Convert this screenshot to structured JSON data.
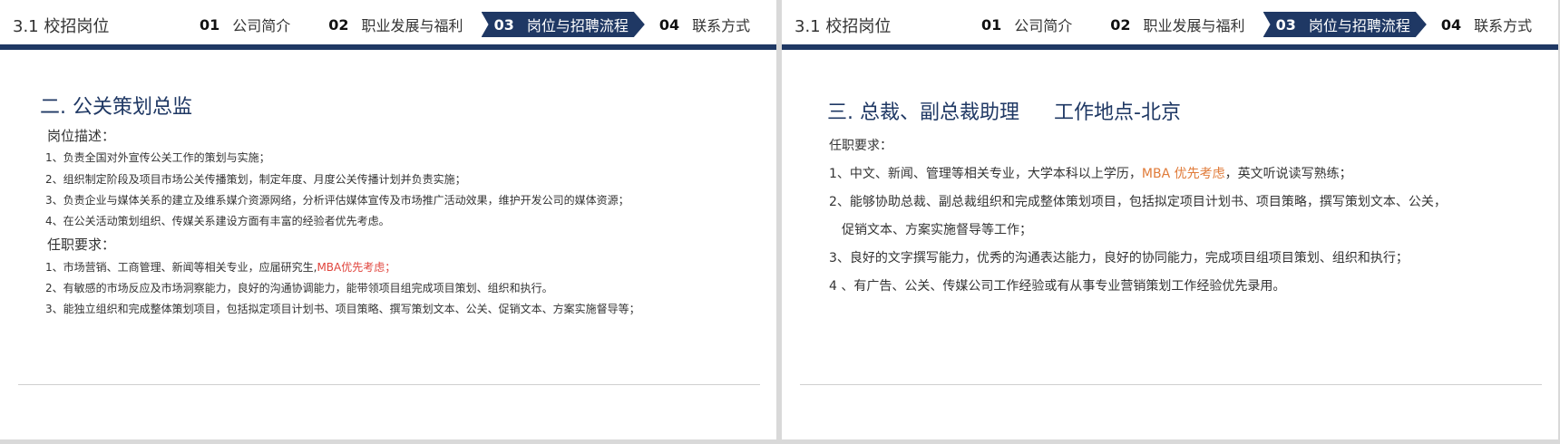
{
  "header": {
    "section_label": "3.1 校招岗位",
    "nav": [
      {
        "num": "01",
        "label": "公司简介",
        "active": false
      },
      {
        "num": "02",
        "label": "职业发展与福利",
        "active": false
      },
      {
        "num": "03",
        "label": "岗位与招聘流程",
        "active": true
      },
      {
        "num": "04",
        "label": "联系方式",
        "active": false
      }
    ]
  },
  "left": {
    "title": "二. 公关策划总监",
    "desc_heading": "岗位描述：",
    "desc_items": [
      "1、负责全国对外宣传公关工作的策划与实施；",
      "2、组织制定阶段及项目市场公关传播策划，制定年度、月度公关传播计划并负责实施；",
      "3、负责企业与媒体关系的建立及维系媒介资源网络，分析评估媒体宣传及市场推广活动效果，维护开发公司的媒体资源；",
      "4、在公关活动策划组织、传媒关系建设方面有丰富的经验者优先考虑。"
    ],
    "req_heading": "任职要求：",
    "req_1_main": "1、市场营销、工商管理、新闻等相关专业，应届研究生,",
    "req_1_highlight": "MBA优先考虑；",
    "req_items": [
      "2、有敏感的市场反应及市场洞察能力，良好的沟通协调能力，能带领项目组完成项目策划、组织和执行。",
      "3、能独立组织和完成整体策划项目，包括拟定项目计划书、项目策略、撰写策划文本、公关、促销文本、方案实施督导等；"
    ]
  },
  "right": {
    "title": "三. 总裁、副总裁助理",
    "location": "工作地点-北京",
    "req_heading": "任职要求：",
    "req_1_main": "1、中文、新闻、管理等相关专业，大学本科以上学历，",
    "req_1_highlight": "MBA  优先考虑",
    "req_1_tail": "，英文听说读写熟练；",
    "req_2a": "2、能够协助总裁、副总裁组织和完成整体策划项目，包括拟定项目计划书、项目策略，撰写策划文本、公关，",
    "req_2b": "促销文本、方案实施督导等工作；",
    "req_3": "3、良好的文字撰写能力，优秀的沟通表达能力，良好的协同能力，完成项目组项目策划、组织和执行；",
    "req_4": "4 、有广告、公关、传媒公司工作经验或有从事专业营销策划工作经验优先录用。"
  },
  "colors": {
    "brand": "#1f3864",
    "highlight_red": "#e0443c",
    "highlight_orange": "#e07b39"
  }
}
